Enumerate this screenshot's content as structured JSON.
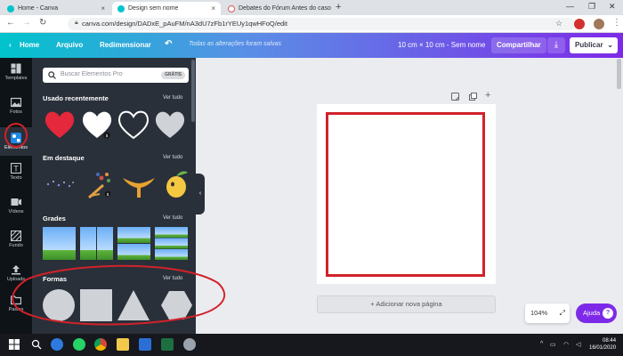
{
  "browser": {
    "tabs": [
      {
        "title": "Home - Canva",
        "active": false
      },
      {
        "title": "Design sem nome",
        "active": true
      },
      {
        "title": "Debates do Fórum Antes do caso",
        "active": false
      }
    ],
    "url": "canva.com/design/DADxE_pAuFM/nA3dU7zFb1rYEUy1qwHFoQ/edit"
  },
  "topbar": {
    "home": "Home",
    "file": "Arquivo",
    "resize": "Redimensionar",
    "saved_status": "Todas as alterações foram salvas",
    "size": "10 cm × 10 cm - Sem nome",
    "share": "Compartilhar",
    "publish": "Publicar"
  },
  "rail": [
    {
      "label": "Templates",
      "icon": "templates-icon"
    },
    {
      "label": "Fotos",
      "icon": "photos-icon"
    },
    {
      "label": "Elementos",
      "icon": "elements-icon"
    },
    {
      "label": "Texto",
      "icon": "text-icon"
    },
    {
      "label": "Vídeos",
      "icon": "video-icon"
    },
    {
      "label": "Fundo",
      "icon": "background-icon"
    },
    {
      "label": "Uploads",
      "icon": "upload-icon"
    },
    {
      "label": "Pastas",
      "icon": "folder-icon"
    }
  ],
  "panel": {
    "search_placeholder": "Buscar Elementos Pro",
    "search_badge": "GRÁTIS",
    "see_all": "Ver tudo",
    "sections": [
      "Usado recentemente",
      "Em destaque",
      "Grades",
      "Formas"
    ],
    "pro_badge": "$"
  },
  "canvas": {
    "add_page": "+ Adicionar nova página",
    "zoom": "104%",
    "help": "Ajuda"
  },
  "taskbar": {
    "time": "08:44",
    "date": "16/01/2020"
  },
  "colors": {
    "accent": "#7d2ae8",
    "teal": "#00c4cc",
    "annotation": "#d1222a"
  }
}
